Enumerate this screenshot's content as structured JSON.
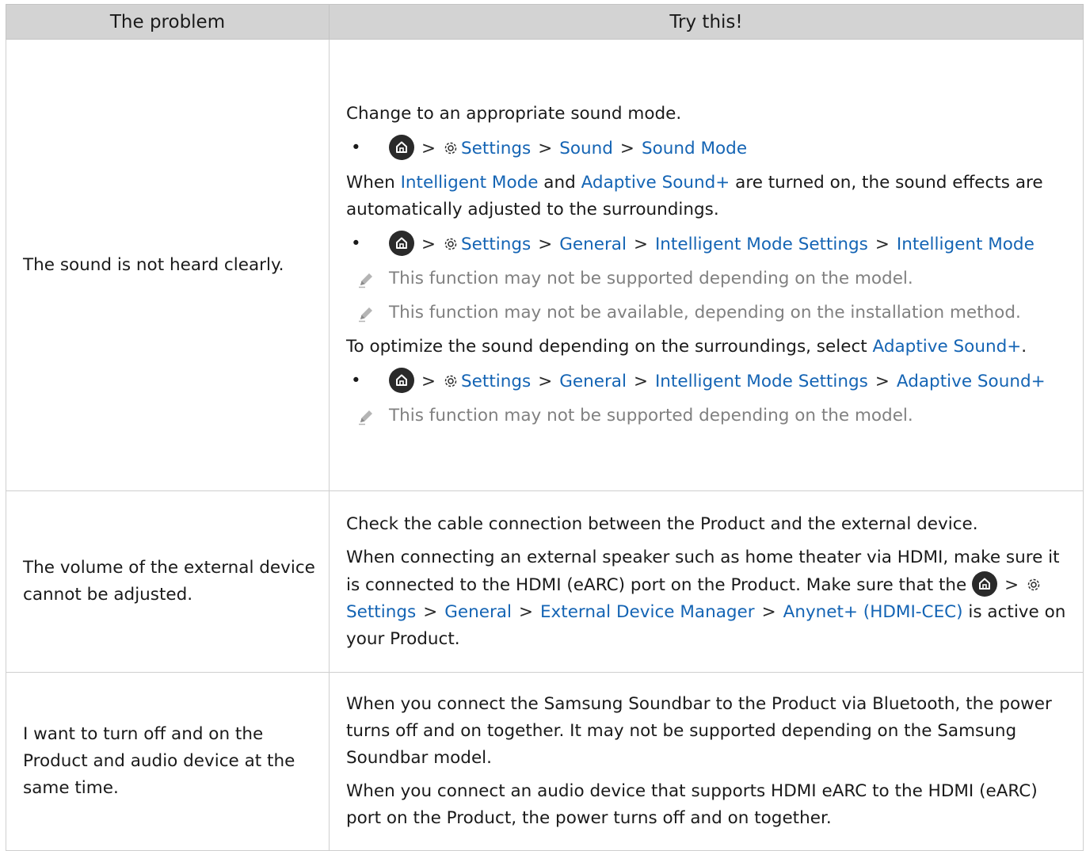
{
  "headers": {
    "problem": "The problem",
    "solution": "Try this!"
  },
  "separator": ">",
  "rows": [
    {
      "problem": "The sound is not heard clearly.",
      "p1": "Change to an appropriate sound mode.",
      "path1": [
        "Settings",
        "Sound",
        "Sound Mode"
      ],
      "p2": {
        "t1": "When ",
        "l1": "Intelligent Mode",
        "t2": " and ",
        "l2": "Adaptive Sound+",
        "t3": " are turned on, the sound effects are automatically adjusted to the surroundings."
      },
      "path2": [
        "Settings",
        "General",
        "Intelligent Mode Settings",
        "Intelligent Mode"
      ],
      "note1": "This function may not be supported depending on the model.",
      "note2": "This function may not be available, depending on the installation method.",
      "p3": {
        "t1": "To optimize the sound depending on the surroundings, select ",
        "l1": "Adaptive Sound+",
        "t2": "."
      },
      "path3": [
        "Settings",
        "General",
        "Intelligent Mode Settings",
        "Adaptive Sound+"
      ],
      "note3": "This function may not be supported depending on the model."
    },
    {
      "problem": "The volume of the external device cannot be adjusted.",
      "p1": "Check the cable connection between the Product and the external device.",
      "p2": {
        "t1": "When connecting an external speaker such as home theater via HDMI, make sure it is connected to the HDMI (eARC) port on the Product. Make sure that the ",
        "path": [
          "Settings",
          "General",
          "External Device Manager",
          "Anynet+ (HDMI-CEC)"
        ],
        "t2": " is active on your Product."
      }
    },
    {
      "problem": "I want to turn off and on the Product and audio device at the same time.",
      "p1": "When you connect the Samsung Soundbar to the Product via Bluetooth, the power turns off and on together. It may not be supported depending on the Samsung Soundbar model.",
      "p2": "When you connect an audio device that supports HDMI eARC to the HDMI (eARC) port on the Product, the power turns off and on together."
    }
  ],
  "colors": {
    "link": "#1464b4",
    "note": "#808080",
    "header_bg": "#d3d3d3"
  },
  "icons": {
    "home": "home-icon",
    "settings": "gear-icon",
    "note": "pencil-icon",
    "bullet": "•"
  }
}
